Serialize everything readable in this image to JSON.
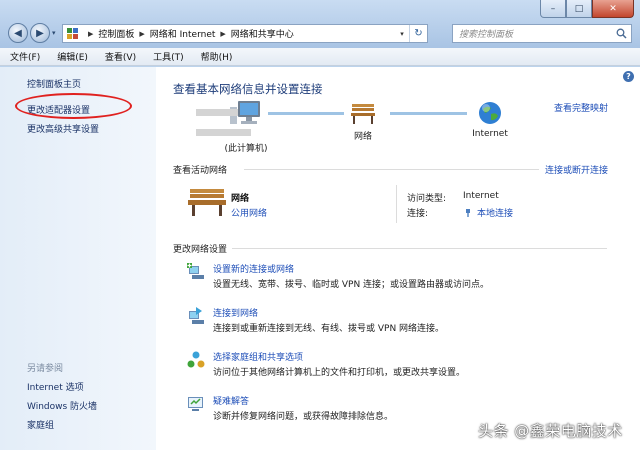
{
  "window": {
    "minimize": "–",
    "maximize": "□",
    "close": "✕"
  },
  "nav": {
    "back": "◀",
    "forward": "▶",
    "recent": "▾"
  },
  "address": {
    "crumbs": [
      "控制面板",
      "网络和 Internet",
      "网络和共享中心"
    ],
    "dropdown": "▾",
    "refresh": "↻"
  },
  "search": {
    "placeholder": "搜索控制面板"
  },
  "menubar": [
    "文件(F)",
    "编辑(E)",
    "查看(V)",
    "工具(T)",
    "帮助(H)"
  ],
  "sidebar": {
    "home": "控制面板主页",
    "links": [
      "更改适配器设置",
      "更改高级共享设置"
    ],
    "see_also_title": "另请参阅",
    "see_also": [
      "Internet 选项",
      "Windows 防火墙",
      "家庭组"
    ]
  },
  "main": {
    "title": "查看基本网络信息并设置连接",
    "full_map": "查看完整映射",
    "help": "?",
    "map": {
      "computer_label": "(此计算机)",
      "network_label": "网络",
      "internet_label": "Internet"
    },
    "active_networks": {
      "heading": "查看活动网络",
      "disconnect": "连接或断开连接",
      "name": "网络",
      "type": "公用网络",
      "access_type_label": "访问类型:",
      "access_type_value": "Internet",
      "connection_label": "连接:",
      "connection_value": "本地连接"
    },
    "change_settings": {
      "heading": "更改网络设置",
      "tasks": [
        {
          "link": "设置新的连接或网络",
          "desc": "设置无线、宽带、拨号、临时或 VPN 连接；或设置路由器或访问点。"
        },
        {
          "link": "连接到网络",
          "desc": "连接到或重新连接到无线、有线、拨号或 VPN 网络连接。"
        },
        {
          "link": "选择家庭组和共享选项",
          "desc": "访问位于其他网络计算机上的文件和打印机，或更改共享设置。"
        },
        {
          "link": "疑难解答",
          "desc": "诊断并修复网络问题，或获得故障排除信息。"
        }
      ]
    }
  },
  "watermark": "头条 @鑫荣电脑技术",
  "colors": {
    "link": "#1f4fb8",
    "title": "#1e3d7a",
    "highlight": "#e0211f"
  }
}
